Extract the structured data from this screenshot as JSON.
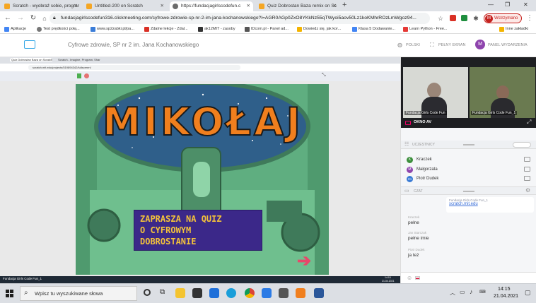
{
  "browser": {
    "tabs": [
      {
        "label": "Scratch - wyobraź sobie, prograr",
        "favicon_color": "#f5a623"
      },
      {
        "label": "Untitled-200 on Scratch",
        "favicon_color": "#f5a623"
      },
      {
        "label": "https://fundacjagirlscodefun.c",
        "favicon_color": "#6b6b6b"
      },
      {
        "label": "Quiz Dobrostan Baza remix on Sc",
        "favicon_color": "#f5a623"
      }
    ],
    "new_tab": "+",
    "url": "fundacjagirlscodefun316.clickmeeting.com/cyfrowe-zdrowie-sp-nr-2-im-jana-kochanowskiego?l=AGR0AGp0ZxO8YKkNz55qTWyoi5aov50Lz1koKMhrROzLmWgoz94...",
    "profile_label": "Wstrzymano",
    "bookmarks": [
      {
        "label": "Aplikacje",
        "color": "#4285f4"
      },
      {
        "label": "Test prędkości połą...",
        "color": "#777"
      },
      {
        "label": "www.sp2zabki.pl/pa...",
        "color": "#3b7dd8"
      },
      {
        "label": "Zdalne lekcje - Zdal...",
        "color": "#d93025"
      },
      {
        "label": "ak12MIT - zasoby",
        "color": "#333"
      },
      {
        "label": "IDcom.pl - Panel ad...",
        "color": "#555"
      },
      {
        "label": "Dowiedz się, jak kor...",
        "color": "#f4b400"
      },
      {
        "label": "Klasa 5 Dodawanie...",
        "color": "#4285f4"
      },
      {
        "label": "Learn Python - Free...",
        "color": "#e53935"
      },
      {
        "label": "Inne zakładki",
        "color": "#f4b400"
      }
    ]
  },
  "header": {
    "title": "Cyfrowe zdrowie, SP nr 2 im. Jana Kochanowskiego",
    "language": "POLSKI",
    "fullscreen": "PEŁNY EKRAN",
    "avatar_letter": "M",
    "event_panel": "PANEL WYDARZENIA"
  },
  "shared_screen": {
    "inner_tabs": [
      "Quiz Dobrostan Baza on Scratch",
      "Scratch - Imagine, Program, Shar"
    ],
    "inner_url": "scratch.mit.edu/projects/519894342/fullscreen/",
    "game_title": "MIKOŁAJ",
    "quiz_line1": "ZAPRASZA NA QUIZ",
    "quiz_line2": "O CYFROWYM",
    "quiz_line3": "DOBROSTANIE",
    "inner_taskbar_label": "Fundacja Girls Code Fun_1",
    "inner_clock_time": "14:15",
    "inner_clock_date": "21.04.2021"
  },
  "video": {
    "left_label": "Fundacja Girls Code Fun",
    "right_label": "Fundacja Girls Code Fun_1",
    "av_window": "OKNO AV"
  },
  "attendees": {
    "header": "UCZESTNICY",
    "list": [
      {
        "name": "Kraczek",
        "initial": "K",
        "color": "#3c8f3c"
      },
      {
        "name": "Małgorzata",
        "initial": "M",
        "color": "#8e44ad"
      },
      {
        "name": "Piotr Dudek",
        "initial": "PD",
        "color": "#3a7bd5"
      }
    ]
  },
  "chat": {
    "header": "CZAT",
    "pinned_name": "Fundacja Girls Code Fun_1",
    "pinned_link": "scratch.mit.edu",
    "messages": [
      {
        "author": "Kraczek",
        "text": "pełne"
      },
      {
        "author": "Jan Starczak",
        "text": "pełne imie"
      },
      {
        "author": "Piotr Dudek",
        "text": "ja też"
      }
    ]
  },
  "taskbar": {
    "search_placeholder": "Wpisz tu wyszukiwane słowa",
    "time": "14:15",
    "date": "21.04.2021"
  },
  "colors": {
    "accent": "#8e44ad",
    "game_bg": "#57a879",
    "quiz_box": "#3b2889",
    "quiz_text": "#f3c23b"
  }
}
